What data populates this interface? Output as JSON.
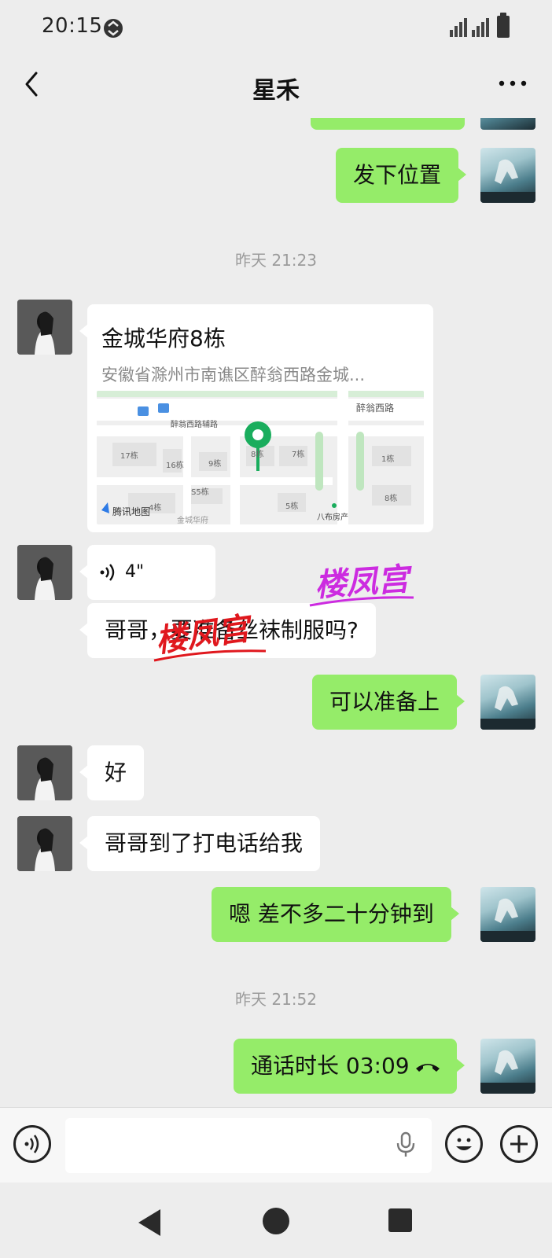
{
  "status_bar": {
    "time": "20:15"
  },
  "header": {
    "title": "星禾"
  },
  "messages": {
    "m1": {
      "text": "发下位置"
    },
    "ts1": "昨天 21:23",
    "location": {
      "title": "金城华府8栋",
      "address": "安徽省滁州市南谯区醉翁西路金城...",
      "map": {
        "road1": "醉翁西路",
        "road2": "醉翁西路辅路",
        "buildings": [
          "17栋",
          "16栋",
          "9栋",
          "8栋",
          "7栋",
          "1栋",
          "S5栋",
          "5栋",
          "8栋",
          "4栋"
        ],
        "poi": "八布房产",
        "bottom": "金城华府",
        "provider": "腾讯地图"
      }
    },
    "voice": {
      "duration": "4\""
    },
    "m3": {
      "text": "哥哥，要准备丝袜制服吗?"
    },
    "m4": {
      "text": "可以准备上"
    },
    "m5": {
      "text": "好"
    },
    "m6": {
      "text": "哥哥到了打电话给我"
    },
    "m7": {
      "text": "嗯 差不多二十分钟到"
    },
    "ts2": "昨天 21:52",
    "call": {
      "text": "通话时长 03:09"
    }
  },
  "watermark": {
    "text": "楼凤宫",
    "colors": [
      "#e0181e",
      "#cc2be0"
    ]
  },
  "input": {
    "placeholder": ""
  },
  "colors": {
    "my_bubble": "#95ec69",
    "other_bubble": "#ffffff",
    "background": "#ededed"
  }
}
